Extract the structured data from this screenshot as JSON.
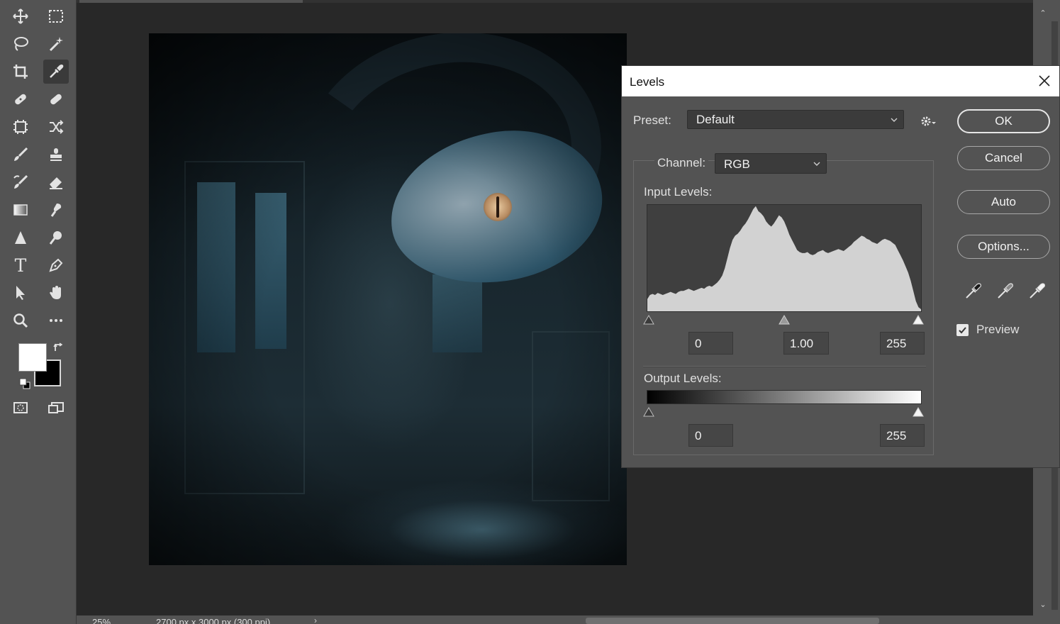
{
  "toolbar": {
    "tools": [
      {
        "name": "move-tool",
        "icon": "move-icon"
      },
      {
        "name": "marquee-tool",
        "icon": "rectangular-marquee-icon"
      },
      {
        "name": "lasso-tool",
        "icon": "lasso-icon"
      },
      {
        "name": "magic-wand-tool",
        "icon": "magic-wand-icon"
      },
      {
        "name": "crop-tool",
        "icon": "crop-icon"
      },
      {
        "name": "eyedropper-tool",
        "icon": "eyedropper-icon",
        "active": true
      },
      {
        "name": "spot-healing-tool",
        "icon": "spot-healing-icon"
      },
      {
        "name": "healing-brush-tool",
        "icon": "bandage-icon"
      },
      {
        "name": "frame-tool",
        "icon": "frame-icon"
      },
      {
        "name": "content-aware-move-tool",
        "icon": "shuffle-icon"
      },
      {
        "name": "brush-tool",
        "icon": "brush-icon"
      },
      {
        "name": "clone-stamp-tool",
        "icon": "stamp-icon"
      },
      {
        "name": "history-brush-tool",
        "icon": "history-brush-icon"
      },
      {
        "name": "eraser-tool",
        "icon": "eraser-icon"
      },
      {
        "name": "gradient-tool",
        "icon": "gradient-icon"
      },
      {
        "name": "smudge-tool",
        "icon": "smudge-icon"
      },
      {
        "name": "sharpen-tool",
        "icon": "triangle-icon"
      },
      {
        "name": "dodge-tool",
        "icon": "dodge-icon"
      },
      {
        "name": "type-tool",
        "icon": "type-icon",
        "glyph": "T"
      },
      {
        "name": "pen-tool",
        "icon": "pen-icon"
      },
      {
        "name": "path-selection-tool",
        "icon": "arrow-pointer-icon"
      },
      {
        "name": "hand-tool",
        "icon": "hand-icon"
      },
      {
        "name": "zoom-tool",
        "icon": "magnifier-icon"
      },
      {
        "name": "more-tools",
        "icon": "ellipsis-icon"
      }
    ],
    "foreground_color": "#ffffff",
    "background_color": "#000000"
  },
  "status": {
    "zoom": "25%",
    "doc_info": "2700 px x 3000 px (300 ppi)"
  },
  "levels": {
    "title": "Levels",
    "preset_label": "Preset:",
    "preset_value": "Default",
    "channel_label": "Channel:",
    "channel_value": "RGB",
    "input_label": "Input Levels:",
    "input_black": "0",
    "input_gamma": "1.00",
    "input_white": "255",
    "output_label": "Output Levels:",
    "output_black": "0",
    "output_white": "255",
    "buttons": {
      "ok": "OK",
      "cancel": "Cancel",
      "auto": "Auto",
      "options": "Options..."
    },
    "preview_label": "Preview",
    "preview_checked": true,
    "histogram": [
      12,
      16,
      17,
      16,
      18,
      17,
      16,
      17,
      18,
      19,
      18,
      17,
      19,
      20,
      20,
      21,
      22,
      21,
      20,
      21,
      22,
      23,
      22,
      24,
      25,
      24,
      26,
      28,
      31,
      35,
      42,
      52,
      62,
      70,
      74,
      76,
      79,
      83,
      86,
      90,
      95,
      100,
      103,
      98,
      96,
      93,
      88,
      85,
      83,
      86,
      90,
      94,
      92,
      88,
      82,
      75,
      70,
      65,
      60,
      58,
      57,
      57,
      58,
      56,
      55,
      56,
      58,
      59,
      60,
      58,
      57,
      58,
      59,
      60,
      61,
      60,
      59,
      61,
      63,
      65,
      68,
      70,
      72,
      74,
      73,
      71,
      70,
      68,
      67,
      66,
      68,
      70,
      71,
      70,
      69,
      67,
      65,
      60,
      55,
      50,
      44,
      38,
      30,
      20,
      10,
      4,
      2
    ]
  }
}
